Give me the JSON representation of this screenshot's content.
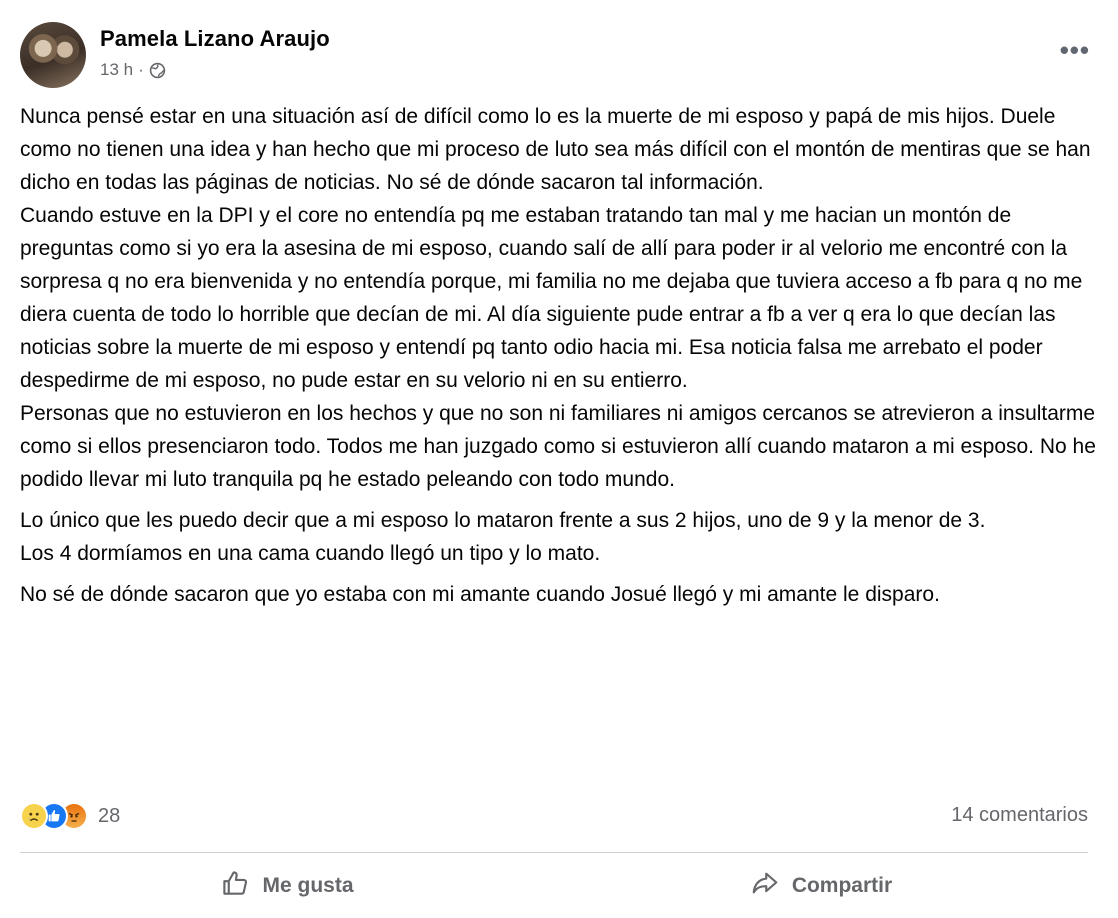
{
  "post": {
    "author": "Pamela Lizano Araujo",
    "time": "13 h",
    "separator": "·",
    "more_label": "•••",
    "paragraphs": [
      "Nunca pensé estar en una situación así de difícil como lo es la muerte de mi esposo y papá de mis hijos. Duele como no tienen una idea y han hecho que mi proceso de luto sea más difícil con el montón de mentiras que se han dicho en todas las páginas de noticias. No sé de dónde sacaron tal información.",
      "Cuando estuve en la DPI y el core no entendía pq me estaban tratando tan mal y me hacian un montón de preguntas como si yo era la asesina de mi esposo, cuando salí de allí para poder ir al velorio me encontré con la sorpresa q no era bienvenida y no entendía porque, mi familia no me dejaba que tuviera acceso a fb para q no me diera cuenta de todo lo horrible que decían de mi. Al día siguiente pude entrar a fb a ver q era lo que decían las noticias sobre la muerte de mi esposo y entendí pq tanto odio hacia mi. Esa noticia falsa me arrebato el poder despedirme de mi esposo, no pude estar en su velorio ni en su entierro.",
      "Personas que no estuvieron en los hechos y que no son ni familiares ni amigos cercanos se atrevieron a insultarme como si ellos presenciaron todo. Todos me han juzgado como si estuvieron allí cuando mataron a mi esposo. No he podido llevar mi luto tranquila pq he estado peleando con todo mundo.",
      "Lo único que les puedo decir que a mi esposo lo mataron frente a sus 2 hijos, uno de 9 y la menor de 3.",
      "Los 4 dormíamos en una cama cuando llegó un tipo y lo mato.",
      "No sé de dónde sacaron que yo estaba con mi amante cuando Josué llegó y mi amante le disparo."
    ],
    "reaction_count": "28",
    "comments_label": "14 comentarios",
    "like_label": "Me gusta",
    "share_label": "Compartir",
    "reaction_icons": [
      "sad-reaction-icon",
      "like-reaction-icon",
      "angry-reaction-icon"
    ],
    "colors": {
      "like_blue": "#1877f2",
      "muted_text": "#65676b",
      "sad_yellow": "#f7d24c",
      "angry_orange": "#e9710f"
    }
  }
}
